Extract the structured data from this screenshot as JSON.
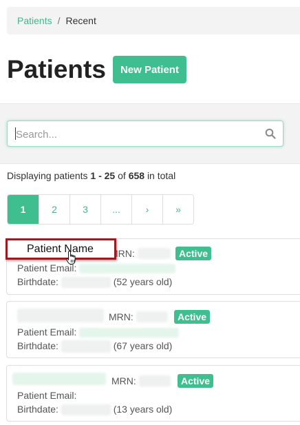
{
  "breadcrumb": {
    "link": "Patients",
    "separator": "/",
    "current": "Recent"
  },
  "header": {
    "title": "Patients",
    "new_button": "New Patient"
  },
  "search": {
    "placeholder": "Search..."
  },
  "summary": {
    "prefix": "Displaying patients",
    "range": "1 - 25",
    "of": "of",
    "total": "658",
    "suffix": "in total"
  },
  "pagination": {
    "pages": [
      "1",
      "2",
      "3",
      "...",
      "›",
      "»"
    ],
    "active": "1"
  },
  "patients": [
    {
      "mrn_label": "MRN:",
      "status": "Active",
      "email_label": "Patient Email:",
      "birthdate_label": "Birthdate:",
      "age": "(52 years old)"
    },
    {
      "mrn_label": "MRN:",
      "status": "Active",
      "email_label": "Patient Email:",
      "birthdate_label": "Birthdate:",
      "age": "(67 years old)"
    },
    {
      "mrn_label": "MRN:",
      "status": "Active",
      "email_label": "Patient Email:",
      "birthdate_label": "Birthdate:",
      "age": "(13 years old)"
    }
  ],
  "tooltip": {
    "text": "Patient Name"
  },
  "colors": {
    "accent": "#3fbe8f",
    "link": "#48b48a",
    "highlight_border": "#9b1b22"
  }
}
